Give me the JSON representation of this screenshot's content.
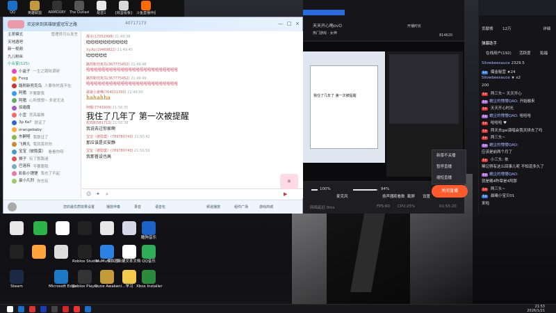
{
  "top_icons": [
    {
      "label": "QQ",
      "color": "#1b6fc8"
    },
    {
      "label": "英雄联盟",
      "color": "#c39a3b"
    },
    {
      "label": "ARMOURY",
      "color": "#222"
    },
    {
      "label": "The Outlast",
      "color": "#444"
    },
    {
      "label": "配音1",
      "color": "#e8e8e8"
    },
    {
      "label": "{收益看板}",
      "color": "#d8d8d8"
    },
    {
      "label": "斗鱼直播伴侣",
      "color": "#ff6a00"
    }
  ],
  "qq": {
    "title": "欢迎来到英雄联盟冠军之路",
    "group_id": "40717173",
    "sidebar": {
      "mode": "主席模式",
      "manage": "管理员可以发言",
      "groups": [
        "天地酒吧",
        "新一视频",
        "九儿粉丝"
      ],
      "channel": "小合宴(125)",
      "members": [
        {
          "name": "小盒子",
          "extra": "一生之路较调研",
          "color": "#e4b"
        },
        {
          "name": "Fxxg",
          "extra": "",
          "color": "#f90"
        },
        {
          "name": "路附新兜克鸟",
          "extra": "人要你时真不在",
          "color": "#c33"
        },
        {
          "name": "阿猪",
          "extra": "不要跟我",
          "color": "#39f"
        },
        {
          "name": "阿猪",
          "extra": "心所想想~ 多说无法",
          "color": "#6a6"
        },
        {
          "name": "如霜魔",
          "extra": "",
          "color": "#a5c"
        },
        {
          "name": "小宜",
          "extra": "死亮最推",
          "color": "#f66"
        },
        {
          "name": "3p Ke?",
          "extra": "铁证了",
          "color": "#36c"
        },
        {
          "name": "orangebaby",
          "extra": "",
          "color": "#fa3"
        },
        {
          "name": "东嗣嗒",
          "extra": "我铁证了",
          "color": "#8b4"
        },
        {
          "name": "飞弊凡",
          "extra": "我就喜欢你",
          "color": "#c83"
        },
        {
          "name": "宝宝（彼隐莫）",
          "extra": "看看你呀",
          "color": "#49c"
        },
        {
          "name": "狮子",
          "extra": "有了那路谜",
          "color": "#d55"
        },
        {
          "name": "巴洛特",
          "extra": "不要跟我",
          "color": "#7ac"
        },
        {
          "name": "彩影小锂锂",
          "extra": "我也了不起",
          "color": "#e7a"
        },
        {
          "name": "最小凡烈",
          "extra": "你也有",
          "color": "#9c6"
        }
      ]
    },
    "messages": [
      {
        "user": "燦子(17052998)",
        "time": "21:49:38",
        "text": "哈哈哈哈哈哈哈哈哈哈",
        "style": "normal"
      },
      {
        "user": "Xy.Ro(19469822)",
        "time": "21:49:45",
        "text": "哈哈哈哈哈",
        "style": "normal"
      },
      {
        "user": "路附新兜克鸟(367775452)",
        "time": "21:49:48",
        "text": "哈哈哈哈哈哈哈哈哈哈哈哈哈哈哈哈哈哈哈哈哈哈哈哈",
        "style": "pink"
      },
      {
        "user": "路附新兜克鸟(367775452)",
        "time": "21:49:49",
        "text": "哈哈哈哈哈哈哈哈哈哈哈哈哈哈哈哈哈哈哈哈哈哈哈哈",
        "style": "pink"
      },
      {
        "user": "歌歌小弟唯(764011350)",
        "time": "21:49:50",
        "text": "hahahha",
        "style": "orange"
      },
      {
        "user": "阿喔(7743909)",
        "time": "21:50:35",
        "text": "我住了几年了 第一次被提醒",
        "style": "big"
      },
      {
        "user": "松鸡B(581713)",
        "time": "21:50:38",
        "text": "我说去过你家啊",
        "style": "normal"
      },
      {
        "user": "宝宝（彼隐莫）(789780743)",
        "time": "21:50:42",
        "text": "那应该是买安静",
        "style": "normal"
      },
      {
        "user": "宝宝（彼隐莫）(789780743)",
        "time": "21:50:59",
        "text": "我那普设也高",
        "style": "normal"
      }
    ],
    "status_items": [
      "您的最优质效果设置",
      "播放伴奏",
      "录音",
      "语音包",
      "频道播放",
      "频道插件",
      "组件广场",
      "游戏商城",
      "游戏陪玩"
    ]
  },
  "stream": {
    "room_title": "天天开心略ovO",
    "room_sub": "热门游戏 · 女神",
    "status": "开播时长",
    "stats": [
      "814620",
      "6"
    ],
    "start_button": "关闭直播",
    "ctx_menu": [
      "新版不关播",
      "暂停直播",
      "缩短直播"
    ],
    "mic_pct": "100%",
    "speaker_pct": "94%",
    "mic_label": "麦克风",
    "speaker_label": "扬声器",
    "bottom_items": [
      "网络延迟 0ms",
      "FPS:60",
      "CPU:25%",
      "内存:35%",
      "01:55:20"
    ],
    "ctrl_labels": [
      "观看数",
      "截屏",
      "设置"
    ]
  },
  "right": {
    "tabs": [
      "贡献榜",
      "12万",
      "详细"
    ],
    "title": "弹幕助手",
    "sub_tabs": [
      "在线用户(192)",
      "活跃度",
      "贴福"
    ],
    "chat": [
      {
        "badge": "",
        "name": "Silowbeesauce",
        "text": "2329.5"
      },
      {
        "badge": "b",
        "name": "",
        "text": "爆金秘营 ★24"
      },
      {
        "badge": "",
        "name": "Silowbeesauce",
        "text": "★ x2"
      },
      {
        "badge": "",
        "name": "",
        "text": "200"
      },
      {
        "badge": "r",
        "name": "",
        "text": "两三头~ 天天开心"
      },
      {
        "badge": "g",
        "name": "蠕尘的懵懵QAO:",
        "text": "开始融来"
      },
      {
        "badge": "r",
        "name": "",
        "text": "天天开心时光"
      },
      {
        "badge": "g",
        "name": "蠕尘的懵懵QAO:",
        "text": "哈哈哈"
      },
      {
        "badge": "r",
        "name": "",
        "text": "哈哈哈 ♥"
      },
      {
        "badge": "r",
        "name": "",
        "text": "两天去gai演唱会我灵拼去了吗"
      },
      {
        "badge": "r",
        "name": "",
        "text": "两三头~"
      },
      {
        "badge": "g",
        "name": "蠕尘的懵懵QAO:",
        "text": ""
      },
      {
        "badge": "",
        "name": "",
        "text": "应该是前两个月了"
      },
      {
        "badge": "r",
        "name": "",
        "text": "小三头: 依"
      },
      {
        "badge": "",
        "name": "",
        "text": "稀记得有这么回事儿呢 不知道多久了"
      },
      {
        "badge": "g",
        "name": "蠕尘的懵懵QAO:",
        "text": ""
      },
      {
        "badge": "",
        "name": "",
        "text": "就是略4昨章是4阿那"
      },
      {
        "badge": "r",
        "name": "",
        "text": "两三头~"
      },
      {
        "badge": "b",
        "name": "",
        "text": "晨曦小宝贝01"
      },
      {
        "badge": "",
        "name": "",
        "text": "来啦"
      }
    ]
  },
  "desktop": [
    {
      "label": "",
      "color": "#e8e8e8"
    },
    {
      "label": "",
      "color": "#2cb34a"
    },
    {
      "label": "",
      "color": "#fff"
    },
    {
      "label": "",
      "color": "#222"
    },
    {
      "label": "",
      "color": "#e8e8e8"
    },
    {
      "label": "",
      "color": "#d8d8e8"
    },
    {
      "label": "酷狗音乐",
      "color": "#1c63c8"
    },
    {
      "label": "",
      "color": "#222"
    },
    {
      "label": "",
      "color": "#ffa43b"
    },
    {
      "label": "",
      "color": "#ddd"
    },
    {
      "label": "Roblox Studio",
      "color": "#222"
    },
    {
      "label": "MuMu模拟器",
      "color": "#2a82e4"
    },
    {
      "label": "新建文本文档",
      "color": "#fff"
    },
    {
      "label": "QQ音乐",
      "color": "#2fae5a"
    },
    {
      "label": "Steam",
      "color": "#1a2a44"
    },
    {
      "label": "Microsoft Edge",
      "color": "#1e78c8"
    },
    {
      "label": "Roblox Player",
      "color": "#333"
    },
    {
      "label": "Dune Awakeni...",
      "color": "#c59a3a"
    },
    {
      "label": "学习",
      "color": "#f2c94c"
    },
    {
      "label": "Xbox Installer",
      "color": "#2b8a3e"
    }
  ],
  "taskbar": {
    "time": "21:53",
    "date": "2026/1/21",
    "icons": [
      "#ffffff",
      "#1b6fc8",
      "#d33",
      "#1d3ab5",
      "#444",
      "#d7262b",
      "#e33",
      "#1b6fc8"
    ]
  }
}
